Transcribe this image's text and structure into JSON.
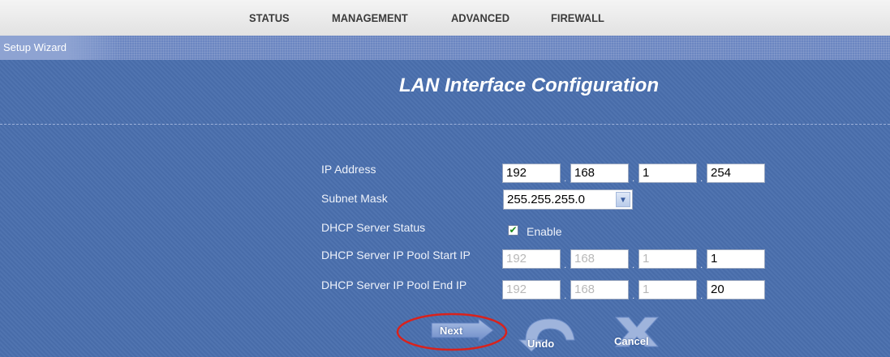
{
  "nav": {
    "items": [
      {
        "label": "STATUS"
      },
      {
        "label": "MANAGEMENT"
      },
      {
        "label": "ADVANCED"
      },
      {
        "label": "FIREWALL"
      }
    ]
  },
  "wizard": {
    "label": "Setup Wizard"
  },
  "page": {
    "title": "LAN Interface Configuration"
  },
  "form": {
    "ip_address": {
      "label": "IP Address",
      "octets": [
        "192",
        "168",
        "1",
        "254"
      ]
    },
    "subnet_mask": {
      "label": "Subnet Mask",
      "value": "255.255.255.0"
    },
    "dhcp_status": {
      "label": "DHCP Server Status",
      "checked": true,
      "option_label": "Enable"
    },
    "pool_start": {
      "label": "DHCP Server IP Pool Start IP",
      "octets": [
        "192",
        "168",
        "1",
        "1"
      ]
    },
    "pool_end": {
      "label": "DHCP Server IP Pool End IP",
      "octets": [
        "192",
        "168",
        "1",
        "20"
      ]
    }
  },
  "buttons": {
    "next": "Next",
    "undo": "Undo",
    "cancel": "Cancel"
  },
  "colors": {
    "panel": "#4a6fae",
    "highlight_ring": "#d9221c"
  }
}
